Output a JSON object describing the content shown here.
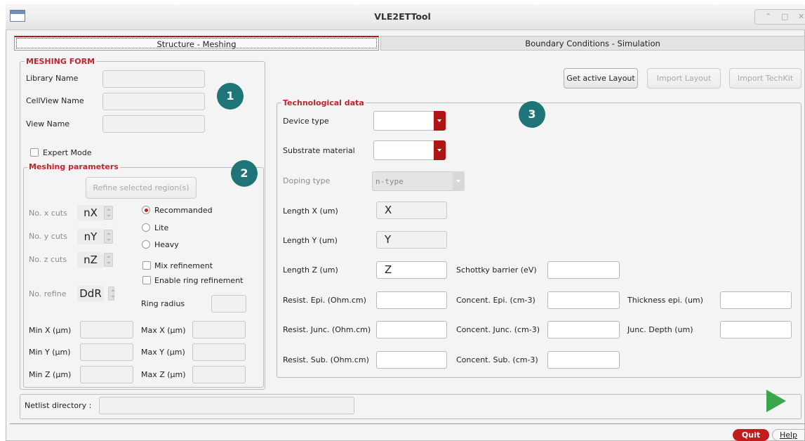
{
  "window": {
    "title": "VLE2ETTool",
    "controls": [
      "⌃",
      "□",
      "✕"
    ]
  },
  "tabs": [
    {
      "label": "Structure - Meshing",
      "active": true
    },
    {
      "label": "Boundary Conditions - Simulation",
      "active": false
    }
  ],
  "meshing_form": {
    "legend": "MESHING FORM",
    "library_name_label": "Library Name",
    "cellview_name_label": "CellView Name",
    "view_name_label": "View Name",
    "expert_mode_label": "Expert Mode"
  },
  "meshing_parameters": {
    "legend": "Meshing parameters",
    "refine_button": "Refine selected region(s)",
    "x_cuts_label": "No. x cuts",
    "x_cuts_value": "nX",
    "y_cuts_label": "No. y cuts",
    "y_cuts_value": "nY",
    "z_cuts_label": "No. z cuts",
    "z_cuts_value": "nZ",
    "refine_label": "No. refine",
    "refine_value": "DdR",
    "radio_recommanded": "Recommanded",
    "radio_lite": "Lite",
    "radio_heavy": "Heavy",
    "mix_refinement": "Mix refinement",
    "enable_ring_refinement": "Enable ring refinement",
    "ring_radius": "Ring radius",
    "min_x": "Min X (µm)",
    "max_x": "Max X (µm)",
    "min_y": "Min Y (µm)",
    "max_y": "Max Y (µm)",
    "min_z": "Min Z (µm)",
    "max_z": "Max Z (µm)"
  },
  "toolbar": {
    "get_active_layout": "Get active Layout",
    "import_layout": "Import Layout",
    "import_techkit": "Import TechKit"
  },
  "tech_data": {
    "legend": "Technological data",
    "device_type": "Device type",
    "substrate_material": "Substrate material",
    "doping_type": "Doping type",
    "doping_type_value": "n-type",
    "length_x": "Length X (um)",
    "length_x_value": "X",
    "length_y": "Length Y (um)",
    "length_y_value": "Y",
    "length_z": "Length Z (um)",
    "length_z_value": "Z",
    "schottky_barrier": "Schottky barrier (eV)",
    "resist_epi": "Resist. Epi. (Ohm.cm)",
    "concent_epi": "Concent. Epi. (cm-3)",
    "thickness_epi": "Thickness epi. (um)",
    "resist_junc": "Resist. Junc. (Ohm.cm)",
    "concent_junc": "Concent. Junc. (cm-3)",
    "junc_depth": "Junc. Depth (um)",
    "resist_sub": "Resist. Sub. (Ohm.cm)",
    "concent_sub": "Concent. Sub. (cm-3)"
  },
  "badges": [
    "1",
    "2",
    "3"
  ],
  "netlist": {
    "label": "Netlist directory :"
  },
  "footer": {
    "quit": "Quit",
    "help": "Help"
  },
  "colors": {
    "accent_red": "#c0252d",
    "badge_teal": "#1f7478",
    "run_green": "#3aa64a"
  }
}
